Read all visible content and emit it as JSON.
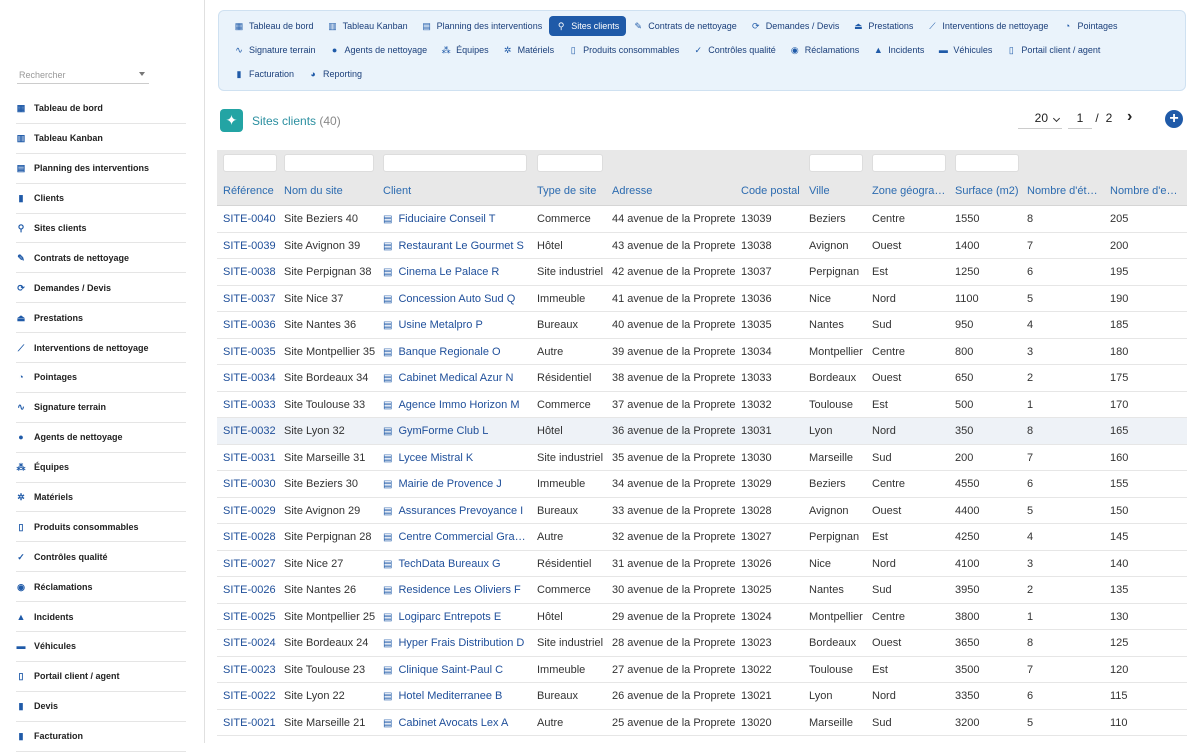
{
  "sidebar": {
    "search_placeholder": "Rechercher",
    "items": [
      {
        "label": "Tableau de bord",
        "icon": "dashboard-icon"
      },
      {
        "label": "Tableau Kanban",
        "icon": "kanban-icon"
      },
      {
        "label": "Planning des interventions",
        "icon": "calendar-icon"
      },
      {
        "label": "Clients",
        "icon": "building-icon"
      },
      {
        "label": "Sites clients",
        "icon": "map-pin-icon"
      },
      {
        "label": "Contrats de nettoyage",
        "icon": "contract-icon"
      },
      {
        "label": "Demandes / Devis",
        "icon": "refresh-icon"
      },
      {
        "label": "Prestations",
        "icon": "service-icon"
      },
      {
        "label": "Interventions de nettoyage",
        "icon": "broom-icon"
      },
      {
        "label": "Pointages",
        "icon": "clock-icon"
      },
      {
        "label": "Signature terrain",
        "icon": "signature-icon"
      },
      {
        "label": "Agents de nettoyage",
        "icon": "user-icon"
      },
      {
        "label": "Équipes",
        "icon": "users-icon"
      },
      {
        "label": "Matériels",
        "icon": "gears-icon"
      },
      {
        "label": "Produits consommables",
        "icon": "bottle-icon"
      },
      {
        "label": "Contrôles qualité",
        "icon": "clipboard-check-icon"
      },
      {
        "label": "Réclamations",
        "icon": "comment-icon"
      },
      {
        "label": "Incidents",
        "icon": "warning-icon"
      },
      {
        "label": "Véhicules",
        "icon": "truck-icon"
      },
      {
        "label": "Portail client / agent",
        "icon": "mobile-icon"
      },
      {
        "label": "Devis",
        "icon": "file-icon"
      },
      {
        "label": "Facturation",
        "icon": "invoice-icon"
      }
    ]
  },
  "topmenu": {
    "rows": [
      [
        {
          "label": "Tableau de bord",
          "icon": "dashboard-icon"
        },
        {
          "label": "Tableau Kanban",
          "icon": "kanban-icon"
        },
        {
          "label": "Planning des interventions",
          "icon": "calendar-icon"
        },
        {
          "label": "Sites clients",
          "icon": "map-pin-icon",
          "active": true
        },
        {
          "label": "Contrats de nettoyage",
          "icon": "contract-icon"
        },
        {
          "label": "Demandes / Devis",
          "icon": "refresh-icon"
        },
        {
          "label": "Prestations",
          "icon": "service-icon"
        },
        {
          "label": "Interventions de nettoyage",
          "icon": "broom-icon"
        },
        {
          "label": "Pointages",
          "icon": "clock-icon"
        }
      ],
      [
        {
          "label": "Signature terrain",
          "icon": "signature-icon"
        },
        {
          "label": "Agents de nettoyage",
          "icon": "user-icon"
        },
        {
          "label": "Équipes",
          "icon": "users-icon"
        },
        {
          "label": "Matériels",
          "icon": "gears-icon"
        },
        {
          "label": "Produits consommables",
          "icon": "bottle-icon"
        },
        {
          "label": "Contrôles qualité",
          "icon": "clipboard-check-icon"
        },
        {
          "label": "Réclamations",
          "icon": "comment-icon"
        },
        {
          "label": "Incidents",
          "icon": "warning-icon"
        },
        {
          "label": "Véhicules",
          "icon": "truck-icon"
        },
        {
          "label": "Portail client / agent",
          "icon": "mobile-icon"
        }
      ],
      [
        {
          "label": "Facturation",
          "icon": "invoice-icon"
        },
        {
          "label": "Reporting",
          "icon": "pie-chart-icon"
        }
      ]
    ]
  },
  "page": {
    "title": "Sites clients",
    "count": "(40)",
    "per_page": "20",
    "current_page": "1",
    "page_sep": "/",
    "total_pages": "2",
    "next_label": "›",
    "add_label": "+"
  },
  "table": {
    "columns": [
      "Référence",
      "Nom du site",
      "Client",
      "Type de site",
      "Adresse",
      "Code postal",
      "Ville",
      "Zone géogra…",
      "Surface (m2)",
      "Nombre d'ét…",
      "Nombre d'e…"
    ],
    "rows": [
      [
        "SITE-0040",
        "Site Beziers 40",
        "Fiduciaire Conseil T",
        "Commerce",
        "44 avenue de la Proprete",
        "13039",
        "Beziers",
        "Centre",
        "1550",
        "8",
        "205"
      ],
      [
        "SITE-0039",
        "Site Avignon 39",
        "Restaurant Le Gourmet S",
        "Hôtel",
        "43 avenue de la Proprete",
        "13038",
        "Avignon",
        "Ouest",
        "1400",
        "7",
        "200"
      ],
      [
        "SITE-0038",
        "Site Perpignan 38",
        "Cinema Le Palace R",
        "Site industriel",
        "42 avenue de la Proprete",
        "13037",
        "Perpignan",
        "Est",
        "1250",
        "6",
        "195"
      ],
      [
        "SITE-0037",
        "Site Nice 37",
        "Concession Auto Sud Q",
        "Immeuble",
        "41 avenue de la Proprete",
        "13036",
        "Nice",
        "Nord",
        "1100",
        "5",
        "190"
      ],
      [
        "SITE-0036",
        "Site Nantes 36",
        "Usine Metalpro P",
        "Bureaux",
        "40 avenue de la Proprete",
        "13035",
        "Nantes",
        "Sud",
        "950",
        "4",
        "185"
      ],
      [
        "SITE-0035",
        "Site Montpellier 35",
        "Banque Regionale O",
        "Autre",
        "39 avenue de la Proprete",
        "13034",
        "Montpellier",
        "Centre",
        "800",
        "3",
        "180"
      ],
      [
        "SITE-0034",
        "Site Bordeaux 34",
        "Cabinet Medical Azur N",
        "Résidentiel",
        "38 avenue de la Proprete",
        "13033",
        "Bordeaux",
        "Ouest",
        "650",
        "2",
        "175"
      ],
      [
        "SITE-0033",
        "Site Toulouse 33",
        "Agence Immo Horizon M",
        "Commerce",
        "37 avenue de la Proprete",
        "13032",
        "Toulouse",
        "Est",
        "500",
        "1",
        "170"
      ],
      [
        "SITE-0032",
        "Site Lyon 32",
        "GymForme Club L",
        "Hôtel",
        "36 avenue de la Proprete",
        "13031",
        "Lyon",
        "Nord",
        "350",
        "8",
        "165"
      ],
      [
        "SITE-0031",
        "Site Marseille 31",
        "Lycee Mistral K",
        "Site industriel",
        "35 avenue de la Proprete",
        "13030",
        "Marseille",
        "Sud",
        "200",
        "7",
        "160"
      ],
      [
        "SITE-0030",
        "Site Beziers 30",
        "Mairie de Provence J",
        "Immeuble",
        "34 avenue de la Proprete",
        "13029",
        "Beziers",
        "Centre",
        "4550",
        "6",
        "155"
      ],
      [
        "SITE-0029",
        "Site Avignon 29",
        "Assurances Prevoyance I",
        "Bureaux",
        "33 avenue de la Proprete",
        "13028",
        "Avignon",
        "Ouest",
        "4400",
        "5",
        "150"
      ],
      [
        "SITE-0028",
        "Site Perpignan 28",
        "Centre Commercial Gra…",
        "Autre",
        "32 avenue de la Proprete",
        "13027",
        "Perpignan",
        "Est",
        "4250",
        "4",
        "145"
      ],
      [
        "SITE-0027",
        "Site Nice 27",
        "TechData Bureaux G",
        "Résidentiel",
        "31 avenue de la Proprete",
        "13026",
        "Nice",
        "Nord",
        "4100",
        "3",
        "140"
      ],
      [
        "SITE-0026",
        "Site Nantes 26",
        "Residence Les Oliviers F",
        "Commerce",
        "30 avenue de la Proprete",
        "13025",
        "Nantes",
        "Sud",
        "3950",
        "2",
        "135"
      ],
      [
        "SITE-0025",
        "Site Montpellier 25",
        "Logiparc Entrepots E",
        "Hôtel",
        "29 avenue de la Proprete",
        "13024",
        "Montpellier",
        "Centre",
        "3800",
        "1",
        "130"
      ],
      [
        "SITE-0024",
        "Site Bordeaux 24",
        "Hyper Frais Distribution D",
        "Site industriel",
        "28 avenue de la Proprete",
        "13023",
        "Bordeaux",
        "Ouest",
        "3650",
        "8",
        "125"
      ],
      [
        "SITE-0023",
        "Site Toulouse 23",
        "Clinique Saint-Paul C",
        "Immeuble",
        "27 avenue de la Proprete",
        "13022",
        "Toulouse",
        "Est",
        "3500",
        "7",
        "120"
      ],
      [
        "SITE-0022",
        "Site Lyon 22",
        "Hotel Mediterranee B",
        "Bureaux",
        "26 avenue de la Proprete",
        "13021",
        "Lyon",
        "Nord",
        "3350",
        "6",
        "115"
      ],
      [
        "SITE-0021",
        "Site Marseille 21",
        "Cabinet Avocats Lex A",
        "Autre",
        "25 avenue de la Proprete",
        "13020",
        "Marseille",
        "Sud",
        "3200",
        "5",
        "110"
      ]
    ],
    "highlighted_row": 8
  }
}
